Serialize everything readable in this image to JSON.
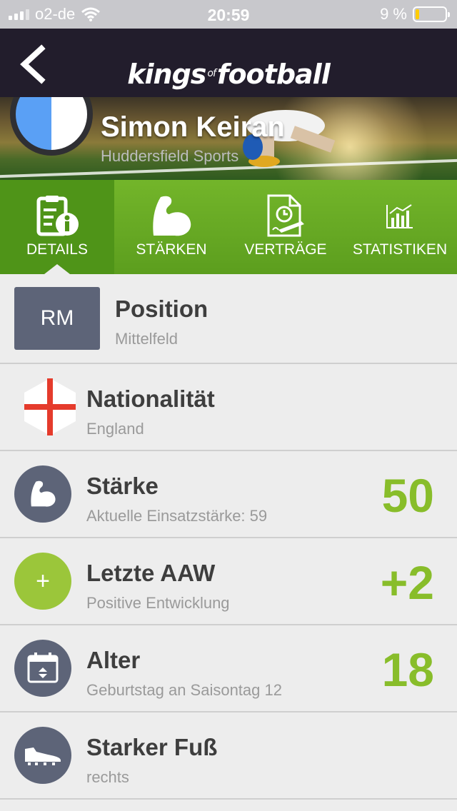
{
  "status_bar": {
    "carrier": "o2-de",
    "time": "20:59",
    "battery": "9 %"
  },
  "nav": {
    "brand_left": "kings",
    "brand_of": "of",
    "brand_right": "football"
  },
  "player": {
    "name": "Simon Keiran",
    "club": "Huddersfield Sports"
  },
  "tabs": [
    {
      "label": "DETAILS",
      "icon": "clipboard-info-icon"
    },
    {
      "label": "STÄRKEN",
      "icon": "flexed-arm-icon"
    },
    {
      "label": "VERTRÄGE",
      "icon": "contract-icon"
    },
    {
      "label": "STATISTIKEN",
      "icon": "bar-chart-icon"
    }
  ],
  "rows": [
    {
      "badge": "RM",
      "title": "Position",
      "sub": "Mittelfeld",
      "value": ""
    },
    {
      "title": "Nationalität",
      "sub": "England",
      "value": ""
    },
    {
      "title": "Stärke",
      "sub": "Aktuelle Einsatzstärke: 59",
      "value": "50"
    },
    {
      "badge": "+",
      "title": "Letzte AAW",
      "sub": "Positive Entwicklung",
      "value": "+2"
    },
    {
      "title": "Alter",
      "sub": "Geburtstag an Saisontag 12",
      "value": "18"
    },
    {
      "title": "Starker Fuß",
      "sub": "rechts",
      "value": ""
    }
  ],
  "colors": {
    "accent_green": "#88bd2a",
    "tab_green": "#5c9e1e",
    "icon_slate": "#5d6478",
    "navbar": "#221d2c"
  }
}
